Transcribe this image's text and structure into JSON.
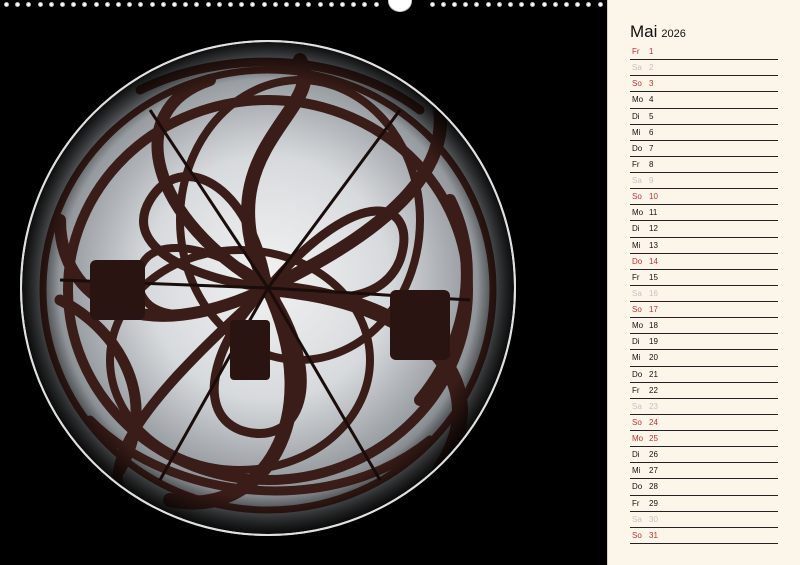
{
  "calendar": {
    "month": "Mai",
    "year": "2026",
    "days": [
      {
        "wd": "Fr",
        "d": "1",
        "type": "sunday"
      },
      {
        "wd": "Sa",
        "d": "2",
        "type": "saturday"
      },
      {
        "wd": "So",
        "d": "3",
        "type": "sunday"
      },
      {
        "wd": "Mo",
        "d": "4",
        "type": "weekday"
      },
      {
        "wd": "Di",
        "d": "5",
        "type": "weekday"
      },
      {
        "wd": "Mi",
        "d": "6",
        "type": "weekday"
      },
      {
        "wd": "Do",
        "d": "7",
        "type": "weekday"
      },
      {
        "wd": "Fr",
        "d": "8",
        "type": "weekday"
      },
      {
        "wd": "Sa",
        "d": "9",
        "type": "saturday"
      },
      {
        "wd": "So",
        "d": "10",
        "type": "sunday"
      },
      {
        "wd": "Mo",
        "d": "11",
        "type": "weekday"
      },
      {
        "wd": "Di",
        "d": "12",
        "type": "weekday"
      },
      {
        "wd": "Mi",
        "d": "13",
        "type": "weekday"
      },
      {
        "wd": "Do",
        "d": "14",
        "type": "sunday"
      },
      {
        "wd": "Fr",
        "d": "15",
        "type": "weekday"
      },
      {
        "wd": "Sa",
        "d": "16",
        "type": "saturday"
      },
      {
        "wd": "So",
        "d": "17",
        "type": "sunday"
      },
      {
        "wd": "Mo",
        "d": "18",
        "type": "weekday"
      },
      {
        "wd": "Di",
        "d": "19",
        "type": "weekday"
      },
      {
        "wd": "Mi",
        "d": "20",
        "type": "weekday"
      },
      {
        "wd": "Do",
        "d": "21",
        "type": "weekday"
      },
      {
        "wd": "Fr",
        "d": "22",
        "type": "weekday"
      },
      {
        "wd": "Sa",
        "d": "23",
        "type": "saturday"
      },
      {
        "wd": "So",
        "d": "24",
        "type": "sunday"
      },
      {
        "wd": "Mo",
        "d": "25",
        "type": "sunday"
      },
      {
        "wd": "Di",
        "d": "26",
        "type": "weekday"
      },
      {
        "wd": "Mi",
        "d": "27",
        "type": "weekday"
      },
      {
        "wd": "Do",
        "d": "28",
        "type": "weekday"
      },
      {
        "wd": "Fr",
        "d": "29",
        "type": "weekday"
      },
      {
        "wd": "Sa",
        "d": "30",
        "type": "saturday"
      },
      {
        "wd": "So",
        "d": "31",
        "type": "sunday"
      }
    ]
  },
  "colors": {
    "paper": "#fcf6ea",
    "sunday_red": "#c0312c",
    "saturday_grey": "#c8c0c0",
    "text": "#111111"
  }
}
